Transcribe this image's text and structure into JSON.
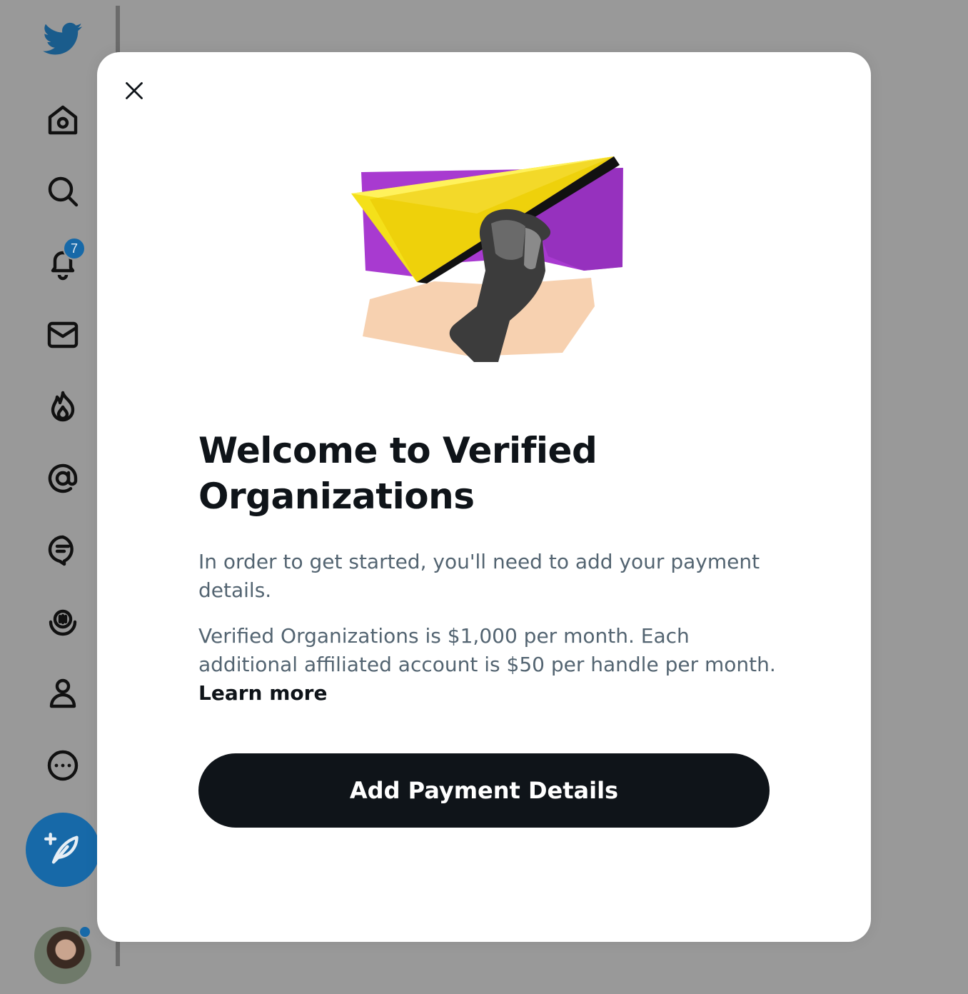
{
  "sidebar": {
    "notifications_badge": "7",
    "items": [
      {
        "icon": "twitter-logo-icon"
      },
      {
        "icon": "home-icon"
      },
      {
        "icon": "search-icon"
      },
      {
        "icon": "notifications-bell-icon"
      },
      {
        "icon": "messages-envelope-icon"
      },
      {
        "icon": "flame-icon"
      },
      {
        "icon": "mention-at-icon"
      },
      {
        "icon": "chat-bubble-icon"
      },
      {
        "icon": "spaces-icon"
      },
      {
        "icon": "profile-icon"
      },
      {
        "icon": "more-icon"
      }
    ],
    "compose_icon": "compose-feather-icon"
  },
  "modal": {
    "close_icon": "close-icon",
    "hero_image": "paper-airplane-hand-illustration",
    "title": "Welcome to Verified Organizations",
    "paragraph_1": "In order to get started, you'll need to add your payment details.",
    "paragraph_2": "Verified Organizations is $1,000 per month. Each additional affiliated account is $50 per handle per month.",
    "learn_more": "Learn more",
    "primary_button": "Add Payment Details"
  },
  "colors": {
    "overlay": "#999999",
    "accent": "#1769a8",
    "text_primary": "#0f1419",
    "text_secondary": "#536471",
    "button_bg": "#0f1419"
  }
}
